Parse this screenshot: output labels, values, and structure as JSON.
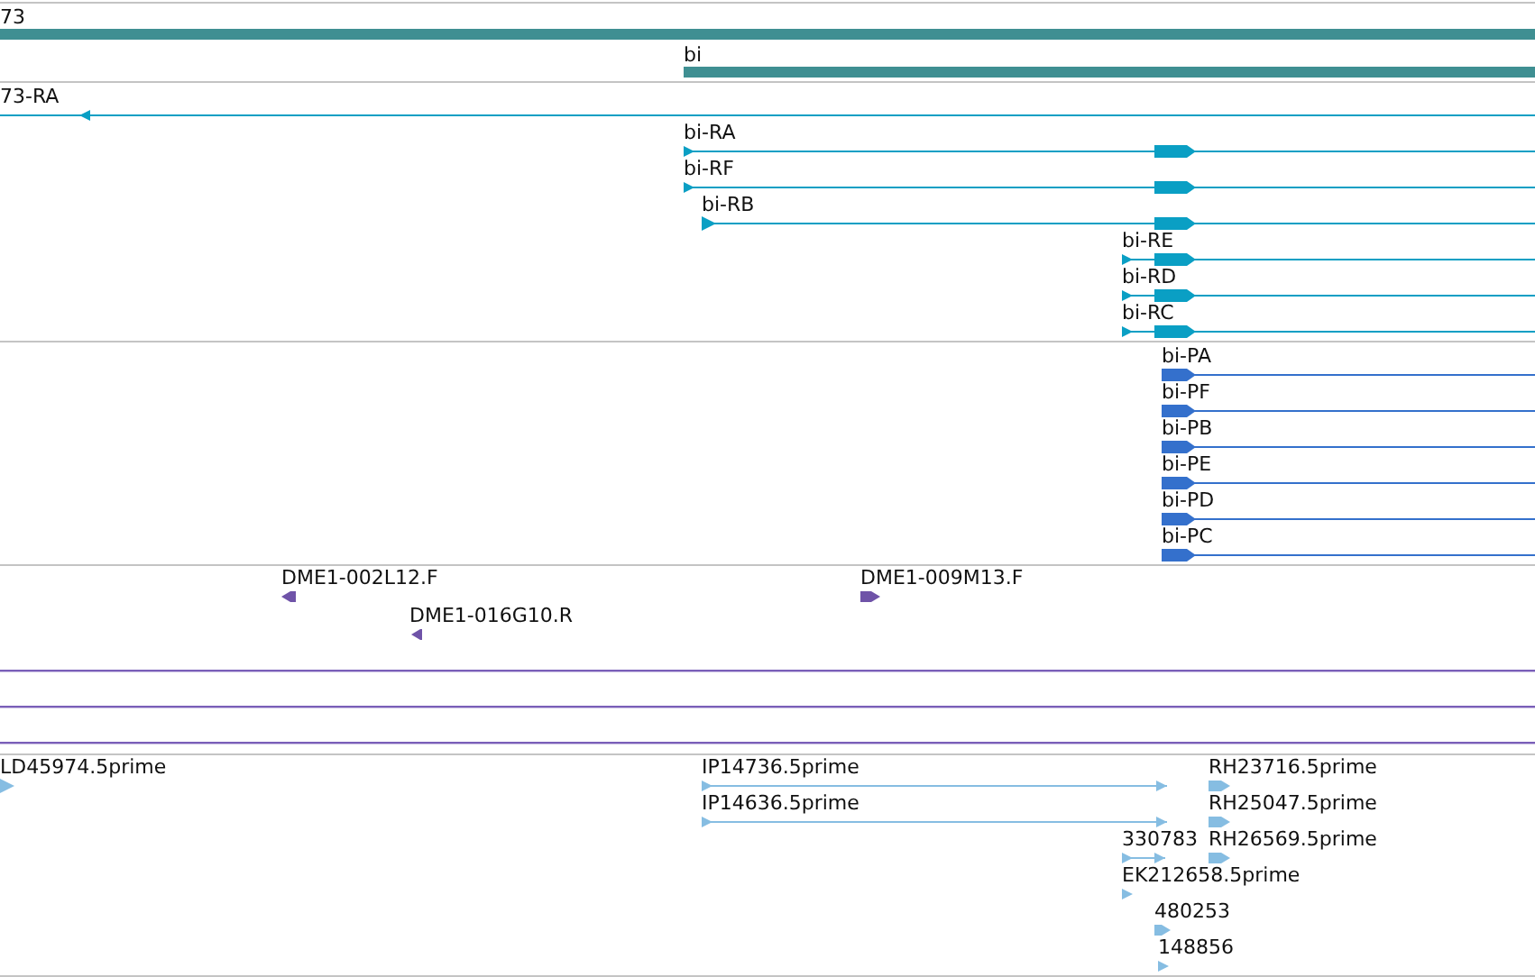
{
  "tracks": [
    {
      "features": [
        {
          "kind": "gene",
          "label": "73"
        },
        {
          "kind": "gene",
          "label": "bi"
        }
      ]
    },
    {
      "features": [
        {
          "kind": "transcript",
          "label": "73-RA",
          "reverse": true
        },
        {
          "kind": "transcript",
          "label": "bi-RA",
          "reverse": false
        },
        {
          "kind": "transcript",
          "label": "bi-RF",
          "reverse": false
        },
        {
          "kind": "transcript",
          "label": "bi-RB",
          "reverse": false
        },
        {
          "kind": "transcript",
          "label": "bi-RE",
          "reverse": false
        },
        {
          "kind": "transcript",
          "label": "bi-RD",
          "reverse": false
        },
        {
          "kind": "transcript",
          "label": "bi-RC",
          "reverse": false
        }
      ]
    },
    {
      "features": [
        {
          "kind": "protein",
          "label": "bi-PA",
          "reverse": false
        },
        {
          "kind": "protein",
          "label": "bi-PF",
          "reverse": false
        },
        {
          "kind": "protein",
          "label": "bi-PB",
          "reverse": false
        },
        {
          "kind": "protein",
          "label": "bi-PE",
          "reverse": false
        },
        {
          "kind": "protein",
          "label": "bi-PD",
          "reverse": false
        },
        {
          "kind": "protein",
          "label": "bi-PC",
          "reverse": false
        }
      ]
    },
    {
      "features": [
        {
          "kind": "clone_end",
          "label": "DME1-002L12.F",
          "reverse": true
        },
        {
          "kind": "clone_end",
          "label": "DME1-016G10.R",
          "reverse": true
        },
        {
          "kind": "clone_end",
          "label": "DME1-009M13.F",
          "reverse": false
        },
        {
          "kind": "span"
        },
        {
          "kind": "span"
        },
        {
          "kind": "span"
        }
      ]
    },
    {
      "features": [
        {
          "kind": "est",
          "label": "LD45974.5prime",
          "reverse": false
        },
        {
          "kind": "est",
          "label": "IP14736.5prime",
          "reverse": false
        },
        {
          "kind": "est",
          "label": "IP14636.5prime",
          "reverse": false
        },
        {
          "kind": "est",
          "label": "RH23716.5prime",
          "reverse": false
        },
        {
          "kind": "est",
          "label": "RH25047.5prime",
          "reverse": false
        },
        {
          "kind": "est",
          "label": "330783",
          "reverse": false
        },
        {
          "kind": "est",
          "label": "RH26569.5prime",
          "reverse": false
        },
        {
          "kind": "est",
          "label": "EK212658.5prime",
          "reverse": false
        },
        {
          "kind": "est",
          "label": "480253",
          "reverse": false
        },
        {
          "kind": "est",
          "label": "148856",
          "reverse": false
        }
      ]
    }
  ]
}
